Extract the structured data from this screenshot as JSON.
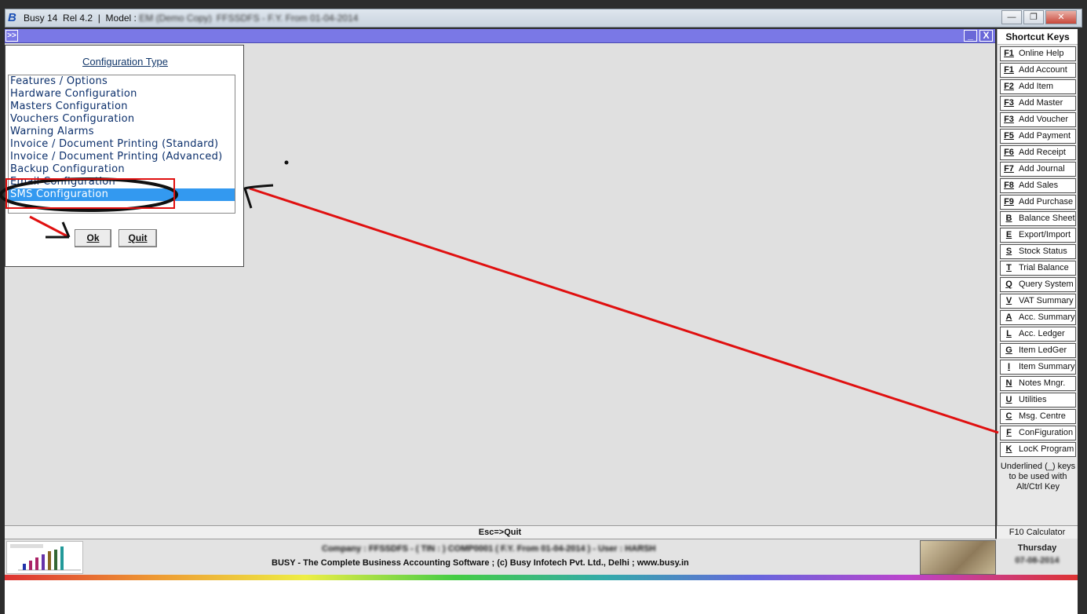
{
  "titlebar": {
    "app_name": "Busy 14",
    "release": "Rel 4.2",
    "separator": "|",
    "model_label": "Model :",
    "model_value": "EM (Demo Copy)",
    "company_fy": "FFSSDFS - F.Y. From 01-04-2014"
  },
  "inner_window": {
    "expand_label": ">>",
    "minimize_label": "_",
    "close_label": "X"
  },
  "dialog": {
    "title": "Configuration Type",
    "items": [
      "Features / Options",
      "Hardware Configuration",
      "Masters Configuration",
      "Vouchers Configuration",
      "Warning Alarms",
      "Invoice / Document Printing (Standard)",
      "Invoice / Document Printing (Advanced)",
      "Backup Configuration",
      "Email Configuration",
      "SMS Configuration"
    ],
    "selected_index": 9,
    "ok_label": "Ok",
    "quit_label": "Quit"
  },
  "shortcuts": {
    "title": "Shortcut Keys",
    "keys": [
      {
        "key": "F1",
        "label": "Online Help"
      },
      {
        "key": "F1",
        "label": "Add Account"
      },
      {
        "key": "F2",
        "label": "Add Item"
      },
      {
        "key": "F3",
        "label": "Add Master"
      },
      {
        "key": "F3",
        "label": "Add Voucher"
      },
      {
        "key": "F5",
        "label": "Add Payment"
      },
      {
        "key": "F6",
        "label": "Add Receipt"
      },
      {
        "key": "F7",
        "label": "Add Journal"
      },
      {
        "key": "F8",
        "label": "Add Sales"
      },
      {
        "key": "F9",
        "label": "Add Purchase"
      },
      {
        "key": "B",
        "label": "Balance Sheet"
      },
      {
        "key": "E",
        "label": "Export/Import"
      },
      {
        "key": "S",
        "label": "Stock Status"
      },
      {
        "key": "T",
        "label": "Trial Balance"
      },
      {
        "key": "Q",
        "label": "Query System"
      },
      {
        "key": "V",
        "label": "VAT Summary"
      },
      {
        "key": "A",
        "label": "Acc. Summary"
      },
      {
        "key": "L",
        "label": "Acc. Ledger"
      },
      {
        "key": "G",
        "label": "Item LedGer"
      },
      {
        "key": "I",
        "label": "Item Summary"
      },
      {
        "key": "N",
        "label": "Notes Mngr."
      },
      {
        "key": "U",
        "label": "Utilities"
      },
      {
        "key": "C",
        "label": "Msg. Centre"
      },
      {
        "key": "F",
        "label": "ConFiguration"
      },
      {
        "key": "K",
        "label": "LocK Program"
      }
    ],
    "note": "Underlined (_) keys to be used with Alt/Ctrl Key"
  },
  "statusbar": {
    "esc_text": "Esc=>Quit",
    "f10_text": "F10 Calculator",
    "company_label": "Company : FFSSDFS - ( TIN : ) COMP0001 ( F.Y. From 01-04-2014 ) - User : HARSH",
    "tagline": "BUSY - The Complete Business Accounting Software  ;  (c) Busy Infotech Pvt. Ltd., Delhi  ;  www.busy.in",
    "day": "Thursday",
    "date": "07-08-2014"
  },
  "colors": {
    "accent_bar": "#7a78e6",
    "selection": "#3399f0",
    "annotation": "#e01010"
  }
}
